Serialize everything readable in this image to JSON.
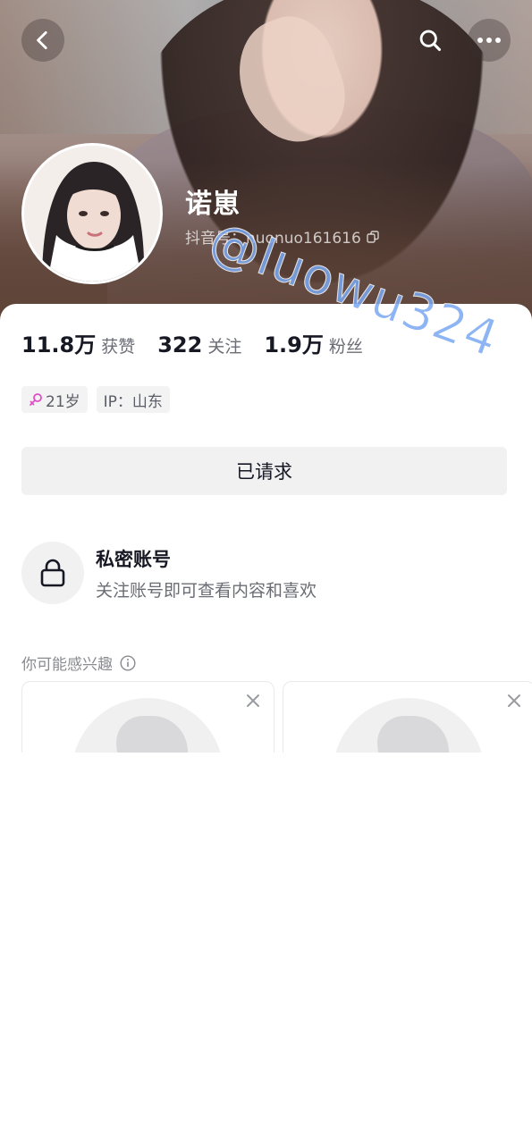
{
  "header": {
    "nickname": "诺崽",
    "douyin_id": "抖音号：nuonuo161616",
    "watermark": "@luowu324"
  },
  "stats": [
    {
      "value": "11.8万",
      "label": "获赞"
    },
    {
      "value": "322",
      "label": "关注"
    },
    {
      "value": "1.9万",
      "label": "粉丝"
    }
  ],
  "tags": {
    "age": "21岁",
    "ip": "IP：山东"
  },
  "follow_button": "已请求",
  "private_account": {
    "title": "私密账号",
    "description": "关注账号即可查看内容和喜欢"
  },
  "suggestions": {
    "heading": "你可能感兴趣"
  },
  "icons": {
    "back": "chevron-left-icon",
    "search": "search-icon",
    "more": "more-icon",
    "copy": "copy-icon",
    "lock": "lock-icon",
    "info": "info-icon",
    "close": "close-icon",
    "gender": "female-icon"
  },
  "colors": {
    "female": "#e04ec4",
    "watermark": "#7aa9f2"
  }
}
